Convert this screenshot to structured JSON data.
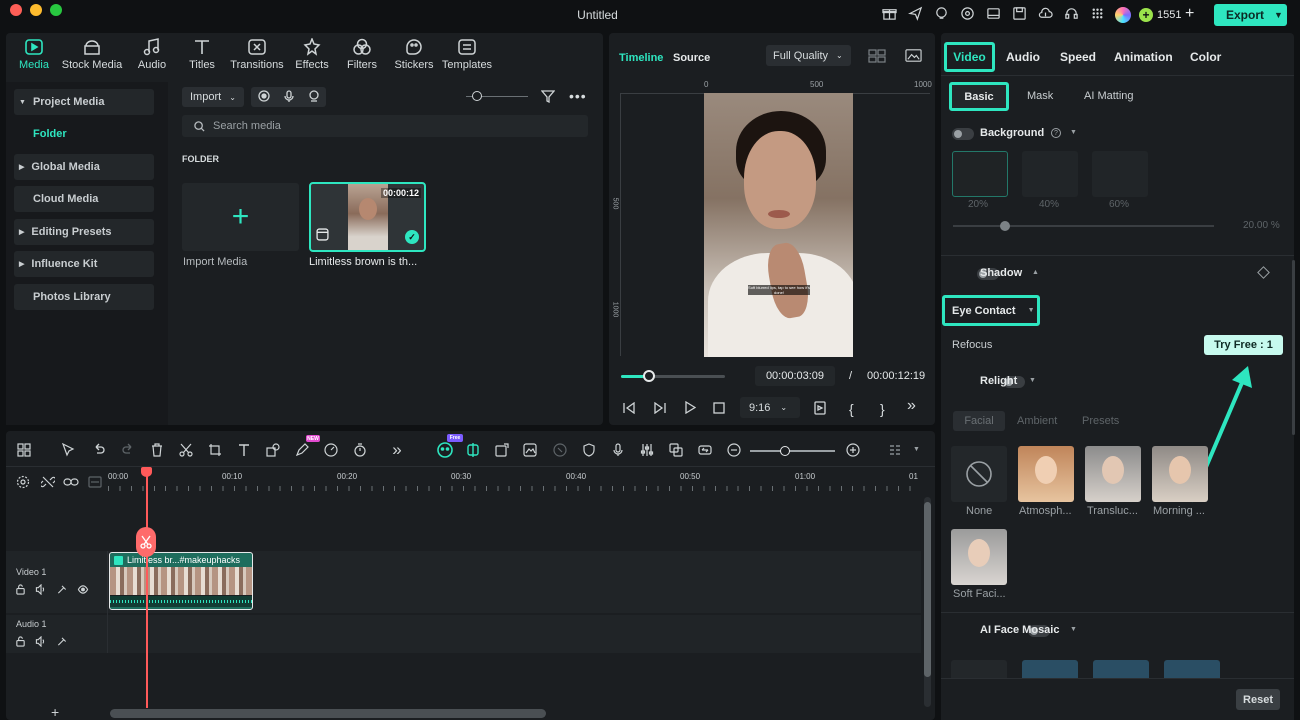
{
  "titlebar": {
    "title": "Untitled",
    "credits": "1551",
    "export_label": "Export"
  },
  "media_tabs": [
    {
      "label": "Media",
      "icon": "media-icon"
    },
    {
      "label": "Stock Media",
      "icon": "stock-media-icon"
    },
    {
      "label": "Audio",
      "icon": "audio-icon"
    },
    {
      "label": "Titles",
      "icon": "titles-icon"
    },
    {
      "label": "Transitions",
      "icon": "transitions-icon"
    },
    {
      "label": "Effects",
      "icon": "effects-icon"
    },
    {
      "label": "Filters",
      "icon": "filters-icon"
    },
    {
      "label": "Stickers",
      "icon": "stickers-icon"
    },
    {
      "label": "Templates",
      "icon": "templates-icon"
    }
  ],
  "sidebar": {
    "items": [
      {
        "label": "Project Media"
      },
      {
        "label": "Folder"
      },
      {
        "label": "Global Media"
      },
      {
        "label": "Cloud Media"
      },
      {
        "label": "Editing Presets"
      },
      {
        "label": "Influence Kit"
      },
      {
        "label": "Photos Library"
      }
    ]
  },
  "media": {
    "import_label": "Import",
    "search_placeholder": "Search media",
    "folder_heading": "FOLDER",
    "import_media_label": "Import Media",
    "clip_name": "Limitless brown is th...",
    "clip_duration": "00:00:12"
  },
  "preview": {
    "tab_timeline": "Timeline",
    "tab_source": "Source",
    "quality": "Full Quality",
    "ruler": [
      "0",
      "500",
      "1000"
    ],
    "vruler": [
      "500",
      "1000"
    ],
    "caption": "Soft blurred lips, tap to see how it's done!",
    "current_time": "00:00:03:09",
    "separator": "/",
    "total_time": "00:00:12:19",
    "aspect": "9:16",
    "progress": 0.27
  },
  "right_panel": {
    "tabs": [
      "Video",
      "Audio",
      "Speed",
      "Animation",
      "Color"
    ],
    "subtabs": [
      "Basic",
      "Mask",
      "AI Matting"
    ],
    "background": {
      "label": "Background",
      "swatches": [
        "20%",
        "40%",
        "60%"
      ],
      "value": "20.00",
      "unit": "%",
      "level": 0.2
    },
    "shadow_label": "Shadow",
    "eye_contact_label": "Eye Contact",
    "refocus_label": "Refocus",
    "try_free_label": "Try Free : 1",
    "relight": {
      "label": "Relight",
      "tabs": [
        "Facial",
        "Ambient",
        "Presets"
      ],
      "presets": [
        "None",
        "Atmosph...",
        "Transluc...",
        "Morning ...",
        "Soft Faci..."
      ]
    },
    "ai_face_mosaic_label": "AI Face Mosaic",
    "reset_label": "Reset"
  },
  "timeline": {
    "time_marks": [
      "00:00",
      "00:10",
      "00:20",
      "00:30",
      "00:40",
      "00:50",
      "01:00",
      "01"
    ],
    "video_track": "Video 1",
    "audio_track": "Audio 1",
    "clip_label": "Limitless br...#makeuphacks",
    "badge_new": "NEW",
    "badge_free": "Free"
  },
  "colors": {
    "accent": "#2ee6c0",
    "playhead": "#ff5a5a",
    "panel": "#1b1e21"
  }
}
